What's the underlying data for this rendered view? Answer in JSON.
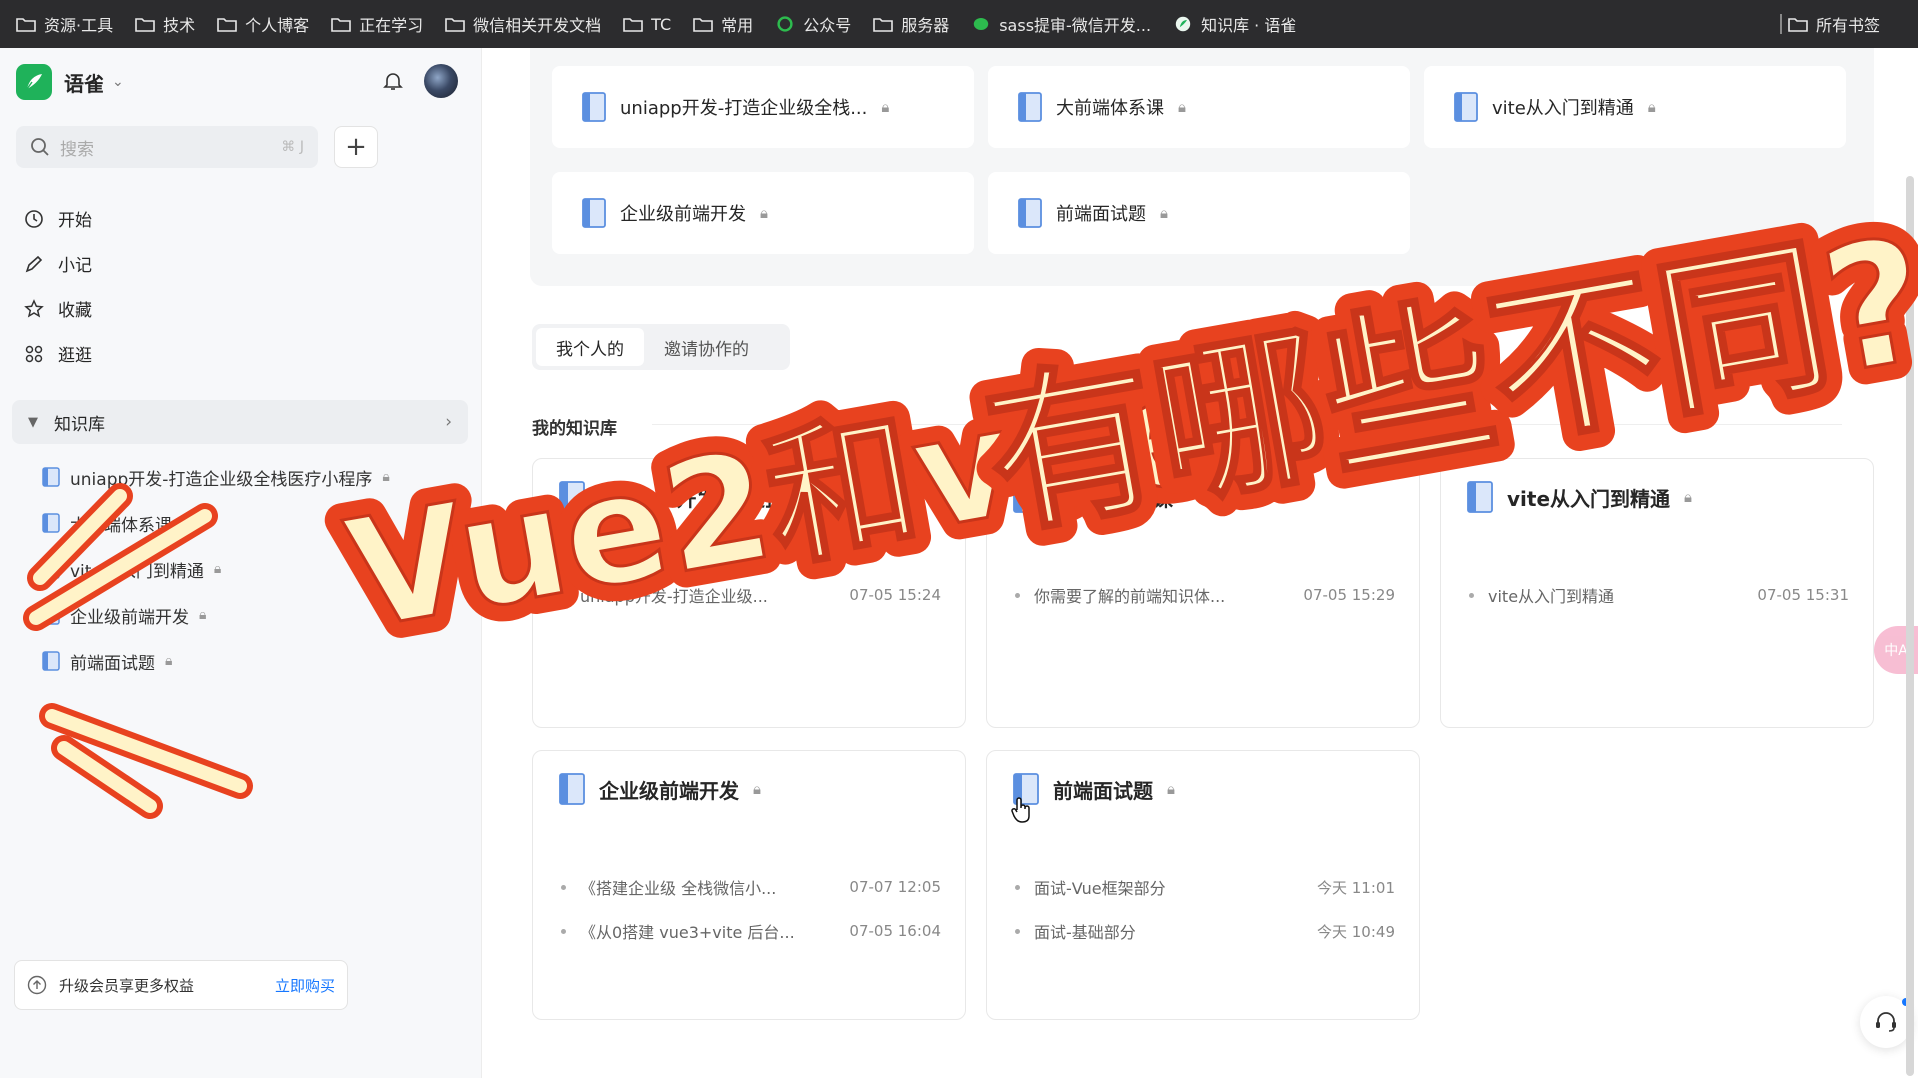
{
  "bookmarks": [
    {
      "label": "资源·工具",
      "icon": "folder-icon"
    },
    {
      "label": "技术",
      "icon": "folder-icon"
    },
    {
      "label": "个人博客",
      "icon": "folder-icon"
    },
    {
      "label": "正在学习",
      "icon": "folder-icon"
    },
    {
      "label": "微信相关开发文档",
      "icon": "folder-icon"
    },
    {
      "label": "TC",
      "icon": "folder-icon"
    },
    {
      "label": "常用",
      "icon": "folder-icon"
    },
    {
      "label": "公众号",
      "icon": "green-logo-icon"
    },
    {
      "label": "服务器",
      "icon": "folder-icon"
    },
    {
      "label": "sass提审-微信开发...",
      "icon": "wechat-icon"
    },
    {
      "label": "知识库 · 语雀",
      "icon": "yuque-icon"
    }
  ],
  "bookmarks_right": "所有书签",
  "sidebar": {
    "app_name": "语雀",
    "search_placeholder": "搜索",
    "search_shortcut": "⌘ J",
    "nav": [
      {
        "label": "开始",
        "icon": "clock-icon"
      },
      {
        "label": "小记",
        "icon": "pen-icon"
      },
      {
        "label": "收藏",
        "icon": "star-icon"
      },
      {
        "label": "逛逛",
        "icon": "apps-icon"
      }
    ],
    "kb_header": "知识库",
    "kb_items": [
      "uniapp开发-打造企业级全栈医疗小程序",
      "大前端体系课",
      "vite从入门到精通",
      "企业级前端开发",
      "前端面试题"
    ],
    "upgrade_text": "升级会员享更多权益",
    "upgrade_buy": "立即购买",
    "more": "更多"
  },
  "main": {
    "quick_cards": [
      "uniapp开发-打造企业级全栈...",
      "大前端体系课",
      "vite从入门到精通",
      "企业级前端开发",
      "前端面试题"
    ],
    "tabs": [
      "我个人的",
      "邀请协作的"
    ],
    "section_title": "我的知识库",
    "books": [
      {
        "title": "uniapp开发-打造企业级全",
        "docs": [
          {
            "title": "uniapp开发-打造企业级...",
            "time": "07-05 15:24"
          }
        ]
      },
      {
        "title": "大前端体系课",
        "docs": [
          {
            "title": "你需要了解的前端知识体...",
            "time": "07-05 15:29"
          }
        ]
      },
      {
        "title": "vite从入门到精通",
        "docs": [
          {
            "title": "vite从入门到精通",
            "time": "07-05 15:31"
          }
        ]
      },
      {
        "title": "企业级前端开发",
        "docs": [
          {
            "title": "《搭建企业级 全栈微信小...",
            "time": "07-07 12:05"
          },
          {
            "title": "《从0搭建 vue3+vite 后台...",
            "time": "07-05 16:04"
          }
        ]
      },
      {
        "title": "前端面试题",
        "docs": [
          {
            "title": "面试-Vue框架部分",
            "time": "今天 11:01"
          },
          {
            "title": "面试-基础部分",
            "time": "今天 10:49"
          }
        ]
      }
    ],
    "translate_badge": "中A"
  },
  "overlay": {
    "headline_part1": "Vue2和vue3",
    "headline_part2": "有哪些不同?"
  },
  "colors": {
    "brand_green": "#1fb25a",
    "link_blue": "#1677ff",
    "book_blue": "#5b8fe0",
    "headline_fill": "#fff3c8",
    "headline_stroke": "#e8421f"
  }
}
